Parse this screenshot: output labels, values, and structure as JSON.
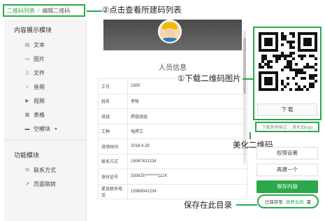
{
  "breadcrumb": {
    "link": "二维码列表",
    "separator": "/",
    "current": "编辑二维码"
  },
  "annotations": {
    "step2": "②点击查看所建码列表",
    "step1": "①下载二维码图片",
    "beautify": "美化二维码",
    "save_dir": "保存在此目录"
  },
  "sidebar": {
    "group1": "内容展示模块",
    "items1": [
      {
        "label": "文本",
        "icon": "text-icon"
      },
      {
        "label": "图片",
        "icon": "image-icon"
      },
      {
        "label": "文件",
        "icon": "file-icon"
      },
      {
        "label": "音频",
        "icon": "audio-icon"
      },
      {
        "label": "视频",
        "icon": "video-icon"
      },
      {
        "label": "表格",
        "icon": "table-icon"
      },
      {
        "label": "空模块",
        "icon": "block-icon"
      }
    ],
    "group2": "功能模块",
    "items2": [
      {
        "label": "联系方式",
        "icon": "contact-icon"
      },
      {
        "label": "页面跳转",
        "icon": "link-icon"
      }
    ]
  },
  "preview": {
    "title": "人员信息",
    "rows": [
      {
        "k": "工号",
        "v": "1805"
      },
      {
        "k": "姓名",
        "v": "李牧"
      },
      {
        "k": "班组",
        "v": "焊接班组"
      },
      {
        "k": "工种",
        "v": "电焊工"
      },
      {
        "k": "进场时间",
        "v": "2018.4.28"
      },
      {
        "k": "联系方式",
        "v": "18067431234"
      },
      {
        "k": "身份证号",
        "v": "330825********112X"
      },
      {
        "k": "紧急联系电话",
        "v": "15968041234"
      }
    ]
  },
  "right_panel": {
    "download": "下 载",
    "more_formats": "下载其他格式",
    "add_logo": "美化加logo",
    "permissions": "权限设置",
    "regenerate": "再建一个",
    "save": "保存内容",
    "saved_status": "已保存至",
    "saved_folder": "培养生码",
    "saved_suffix": "夏"
  },
  "colors": {
    "accent": "#2aa84a"
  }
}
